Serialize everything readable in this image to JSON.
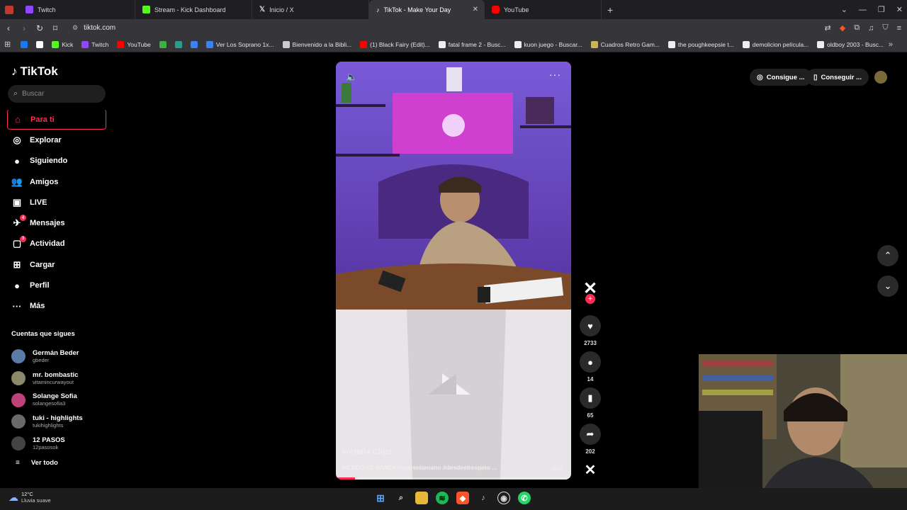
{
  "browser": {
    "tabs": [
      {
        "label": "Twitch",
        "icon": "twitch-icon",
        "color": "#9146ff"
      },
      {
        "label": "Stream - Kick Dashboard",
        "icon": "kick-icon",
        "color": "#53fc18"
      },
      {
        "label": "Inicio / X",
        "icon": "x-icon",
        "color": "#ffffff"
      },
      {
        "label": "TikTok - Make Your Day",
        "icon": "tiktok-icon",
        "color": "#ffffff",
        "active": true
      },
      {
        "label": "YouTube",
        "icon": "youtube-icon",
        "color": "#ff0000"
      }
    ],
    "url": "tiktok.com",
    "bookmarks": [
      {
        "label": "",
        "color": "#1877f2"
      },
      {
        "label": "",
        "color": "#ffffff"
      },
      {
        "label": "Kick",
        "color": "#53fc18"
      },
      {
        "label": "Twitch",
        "color": "#9146ff"
      },
      {
        "label": "YouTube",
        "color": "#ff0000"
      },
      {
        "label": "",
        "color": "#3cb043"
      },
      {
        "label": "",
        "color": "#2a9d8f"
      },
      {
        "label": "",
        "color": "#3b82f6"
      },
      {
        "label": "Ver Los Soprano 1x...",
        "color": "#3b82f6"
      },
      {
        "label": "Bienvenido a la Bibli...",
        "color": "#cccccc"
      },
      {
        "label": "(1) Black Fairy (Edit)...",
        "color": "#ff0000"
      },
      {
        "label": "fatal frame 2 - Busc...",
        "color": "#eeeeee"
      },
      {
        "label": "kuon juego - Buscar...",
        "color": "#eeeeee"
      },
      {
        "label": "Cuadros Retro Gam...",
        "color": "#c9b458"
      },
      {
        "label": "the poughkeepsie t...",
        "color": "#eeeeee"
      },
      {
        "label": "demolicion película...",
        "color": "#eeeeee"
      },
      {
        "label": "oldboy 2003 - Busc...",
        "color": "#eeeeee"
      }
    ]
  },
  "tiktok": {
    "logo": "TikTok",
    "search_placeholder": "Buscar",
    "menu": [
      {
        "label": "Para ti",
        "icon": "home-icon",
        "glyph": "⌂",
        "active": true
      },
      {
        "label": "Explorar",
        "icon": "compass-icon",
        "glyph": "◎"
      },
      {
        "label": "Siguiendo",
        "icon": "following-icon",
        "glyph": "●"
      },
      {
        "label": "Amigos",
        "icon": "friends-icon",
        "glyph": "👥"
      },
      {
        "label": "LIVE",
        "icon": "live-icon",
        "glyph": "▣"
      },
      {
        "label": "Mensajes",
        "icon": "messages-icon",
        "glyph": "✈",
        "badge": "4"
      },
      {
        "label": "Actividad",
        "icon": "activity-icon",
        "glyph": "▢",
        "badge": "3"
      },
      {
        "label": "Cargar",
        "icon": "upload-icon",
        "glyph": "⊞"
      },
      {
        "label": "Perfil",
        "icon": "profile-icon",
        "glyph": "●"
      },
      {
        "label": "Más",
        "icon": "more-icon",
        "glyph": "···"
      }
    ],
    "following_title": "Cuentas que sigues",
    "following": [
      {
        "name": "Germán Beder",
        "user": "gbeder",
        "color": "#5a7aa8"
      },
      {
        "name": "mr. bombastic",
        "user": "vitamincurwayout",
        "color": "#8a8a6a"
      },
      {
        "name": "Solange Sofia",
        "user": "solangesofia3",
        "color": "#c0407a"
      },
      {
        "name": "tuki - highlights",
        "user": "tukihighlights",
        "color": "#6a6a6a"
      },
      {
        "name": "12 PASOS",
        "user": "12pasosok",
        "color": "#444444"
      }
    ],
    "see_all": "Ver todo",
    "video": {
      "author": "Vorterix Clips",
      "caption": "METIDO EL PANZAS#parenlamano #desdeelrespeto ...",
      "more": "más",
      "progress": 0.08
    },
    "actions": {
      "likes": "2733",
      "comments": "14",
      "saves": "65",
      "shares": "202"
    },
    "top_right": {
      "coins_label": "Consigue ...",
      "app_label": "Conseguir ..."
    }
  },
  "taskbar": {
    "temp": "12°C",
    "weather": "Lluvia suave"
  }
}
